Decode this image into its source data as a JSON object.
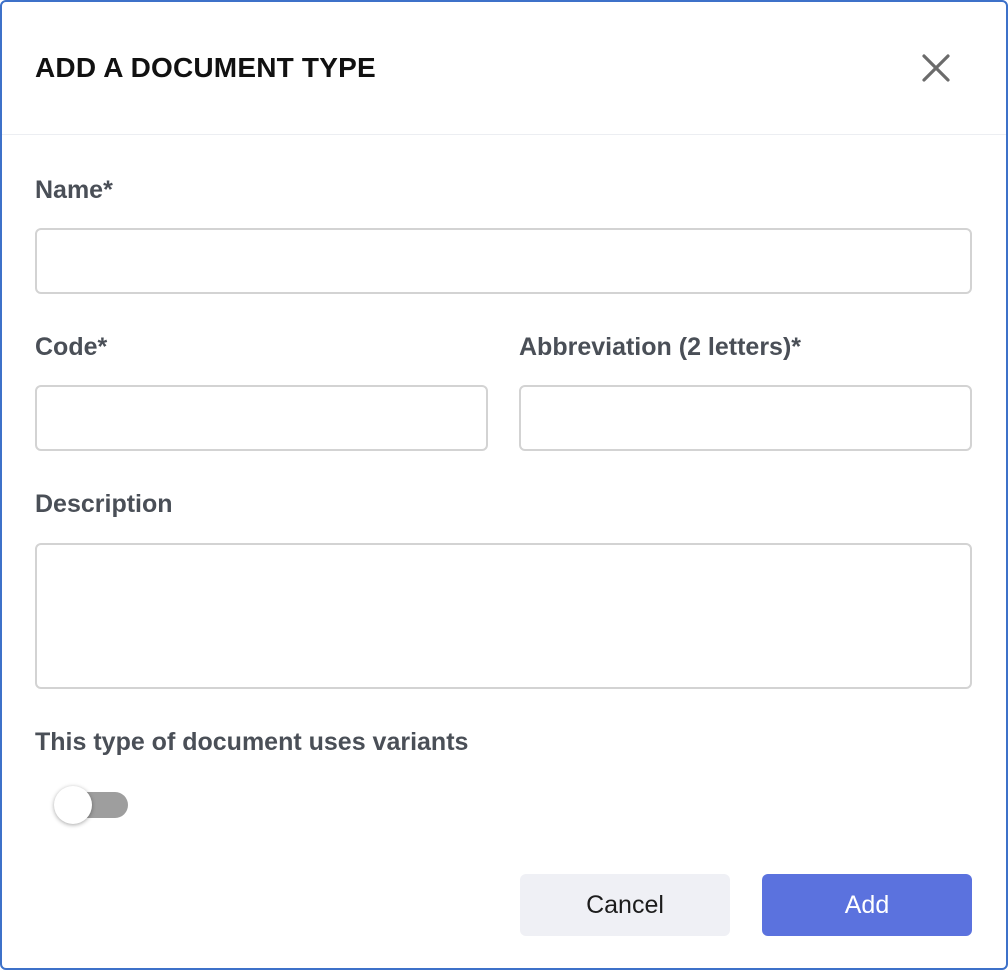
{
  "dialog": {
    "title": "ADD A DOCUMENT TYPE",
    "close_icon": "close-icon"
  },
  "form": {
    "name": {
      "label": "Name*",
      "value": "",
      "placeholder": ""
    },
    "code": {
      "label": "Code*",
      "value": "",
      "placeholder": ""
    },
    "abbreviation": {
      "label": "Abbreviation (2 letters)*",
      "value": "",
      "placeholder": ""
    },
    "description": {
      "label": "Description",
      "value": "",
      "placeholder": ""
    },
    "variants": {
      "label": "This type of document uses variants",
      "enabled": false
    }
  },
  "actions": {
    "cancel_label": "Cancel",
    "add_label": "Add"
  },
  "colors": {
    "dialog_border": "#3d71c9",
    "primary": "#5b72de",
    "secondary_bg": "#eff0f5",
    "toggle_off": "#9e9e9e",
    "label_text": "#4a4f57"
  }
}
